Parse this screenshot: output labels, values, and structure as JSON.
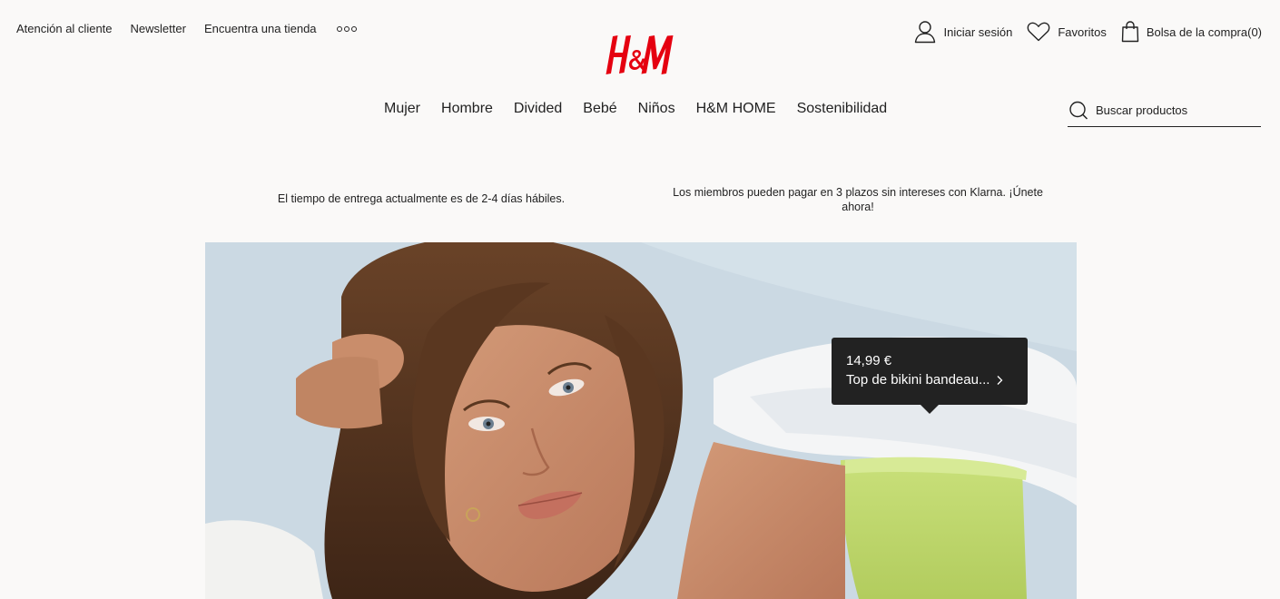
{
  "utility": {
    "customer_service": "Atención al cliente",
    "newsletter": "Newsletter",
    "find_store": "Encuentra una tienda",
    "more_icon": "more-dots-icon"
  },
  "account": {
    "login": "Iniciar sesión",
    "favorites": "Favoritos",
    "bag": "Bolsa de la compra(0)"
  },
  "brand": {
    "logo_text": "H&M",
    "logo_color": "#e50010"
  },
  "nav": {
    "items": [
      "Mujer",
      "Hombre",
      "Divided",
      "Bebé",
      "Niños",
      "H&M HOME",
      "Sostenibilidad"
    ]
  },
  "search": {
    "placeholder": "Buscar productos",
    "icon": "search-icon"
  },
  "notices": {
    "delivery": "El tiempo de entrega actualmente es de 2-4 días hábiles.",
    "klarna": "Los miembros pueden pagar en 3 plazos sin intereses con Klarna. ¡Únete ahora!"
  },
  "hero": {
    "tooltip": {
      "price": "14,99 €",
      "product_name": "Top de bikini bandeau...",
      "arrow_icon": "chevron-right-icon"
    }
  }
}
